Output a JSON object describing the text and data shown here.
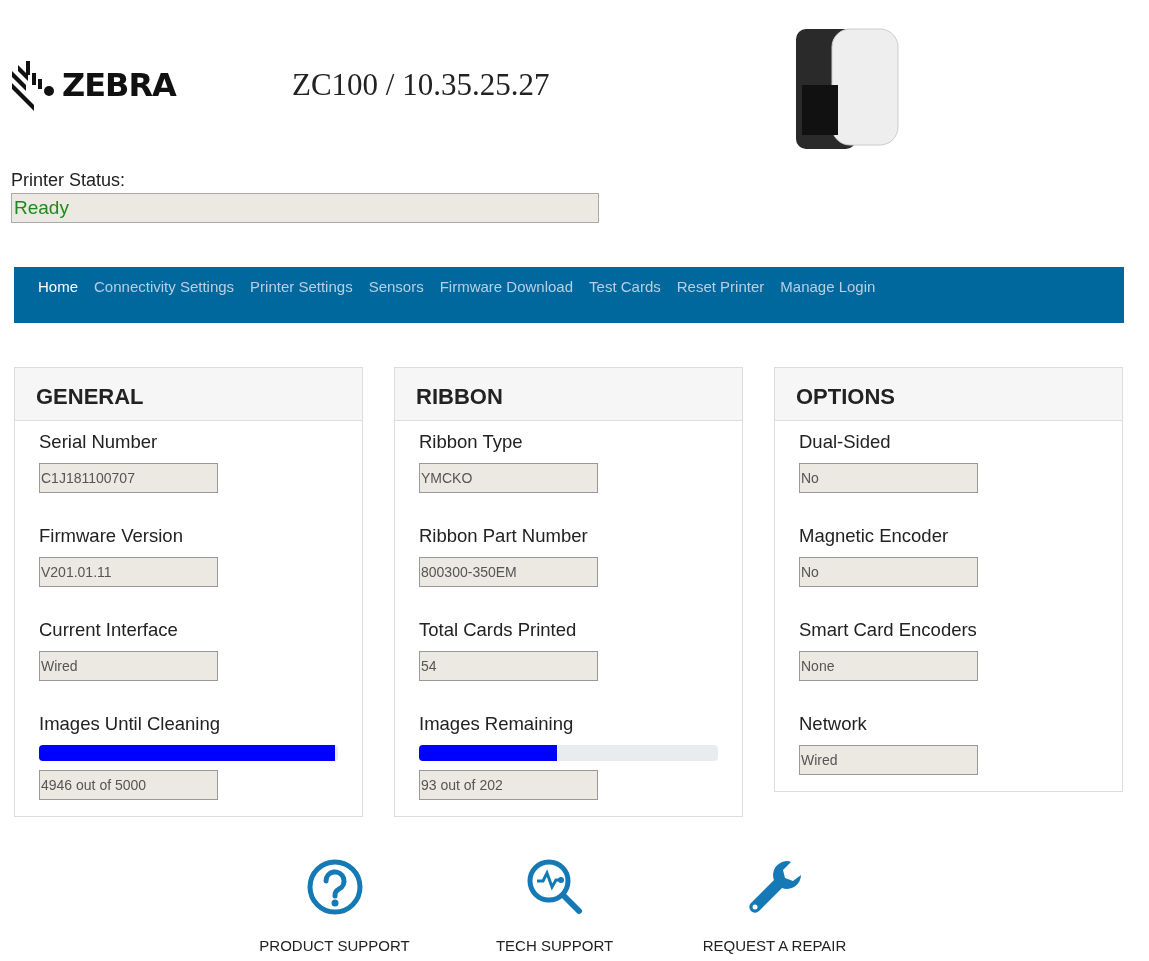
{
  "header": {
    "logo": "ZEBRA",
    "title": "ZC100 / 10.35.25.27"
  },
  "status": {
    "label": "Printer Status:",
    "value": "Ready"
  },
  "nav": [
    {
      "label": "Home",
      "selected": true
    },
    {
      "label": "Connectivity Settings",
      "selected": false
    },
    {
      "label": "Printer Settings",
      "selected": false
    },
    {
      "label": "Sensors",
      "selected": false
    },
    {
      "label": "Firmware Download",
      "selected": false
    },
    {
      "label": "Test Cards",
      "selected": false
    },
    {
      "label": "Reset Printer",
      "selected": false
    },
    {
      "label": "Manage Login",
      "selected": false
    }
  ],
  "cards": [
    {
      "title": "GENERAL",
      "items": [
        {
          "kind": "field",
          "label": "Serial Number",
          "value": "C1J181100707"
        },
        {
          "kind": "field",
          "label": "Firmware Version",
          "value": "V201.01.11"
        },
        {
          "kind": "field",
          "label": "Current Interface",
          "value": "Wired"
        },
        {
          "kind": "progress",
          "label": "Images Until Cleaning",
          "level": 0.989,
          "value": "4946 out of 5000"
        }
      ]
    },
    {
      "title": "RIBBON",
      "items": [
        {
          "kind": "field",
          "label": "Ribbon Type",
          "value": "YMCKO"
        },
        {
          "kind": "field",
          "label": "Ribbon Part Number",
          "value": "800300-350EM"
        },
        {
          "kind": "field",
          "label": "Total Cards Printed",
          "value": "54"
        },
        {
          "kind": "progress",
          "label": "Images Remaining",
          "level": 0.46,
          "value": "93 out of 202"
        }
      ]
    },
    {
      "title": "OPTIONS",
      "items": [
        {
          "kind": "field",
          "label": "Dual-Sided",
          "value": "No"
        },
        {
          "kind": "field",
          "label": "Magnetic Encoder",
          "value": "No"
        },
        {
          "kind": "field",
          "label": "Smart Card Encoders",
          "value": "None"
        },
        {
          "kind": "field",
          "label": "Network",
          "value": "Wired"
        }
      ]
    }
  ],
  "support": [
    {
      "kind": "help",
      "label": "PRODUCT SUPPORT"
    },
    {
      "kind": "diagnostic",
      "label": "TECH SUPPORT"
    },
    {
      "kind": "repair",
      "label": "REQUEST A REPAIR"
    }
  ]
}
